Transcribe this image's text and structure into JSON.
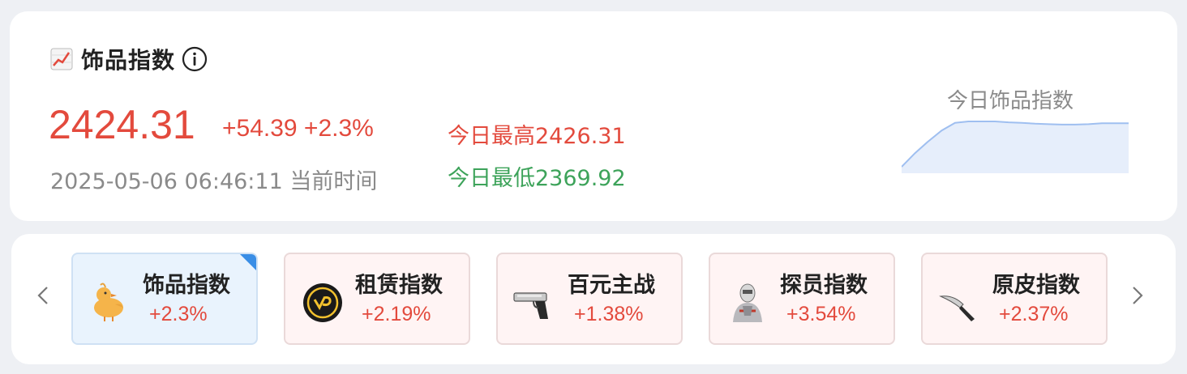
{
  "header": {
    "title": "饰品指数",
    "price": "2424.31",
    "change": "+54.39 +2.3%",
    "timestamp": "2025-05-06 06:46:11 当前时间",
    "high": "今日最高2426.31",
    "low": "今日最低2369.92"
  },
  "sparkline": {
    "label": "今日饰品指数",
    "values": [
      0.0,
      0.3,
      0.56,
      0.8,
      0.97,
      1.0,
      1.0,
      1.0,
      0.98,
      0.97,
      0.95,
      0.94,
      0.93,
      0.93,
      0.94,
      0.96,
      0.96,
      0.96
    ],
    "line_color": "#9fbff0",
    "fill_color": "#e6eefb"
  },
  "colors": {
    "up": "#e34a3d",
    "down": "#3da35a",
    "accent": "#3a8ee6"
  },
  "tiles": [
    {
      "name": "饰品指数",
      "pct": "+2.3%",
      "icon": "duck-icon",
      "active": true
    },
    {
      "name": "租赁指数",
      "pct": "+2.19%",
      "icon": "rent-coin-icon",
      "active": false
    },
    {
      "name": "百元主战",
      "pct": "+1.38%",
      "icon": "desert-eagle-icon",
      "active": false
    },
    {
      "name": "探员指数",
      "pct": "+3.54%",
      "icon": "agent-icon",
      "active": false
    },
    {
      "name": "原皮指数",
      "pct": "+2.37%",
      "icon": "knife-icon",
      "active": false
    }
  ]
}
